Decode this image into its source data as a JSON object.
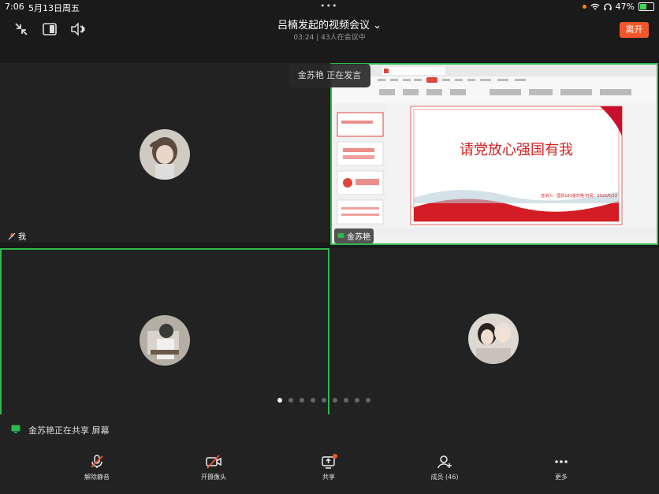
{
  "status": {
    "time": "7:06",
    "date": "5月13日周五",
    "battery": "47%",
    "battery_fraction": 0.47
  },
  "meeting": {
    "title": "吕楠发起的视频会议",
    "duration": "03:24",
    "attendees": "43人在会议中",
    "leave_label": "离开"
  },
  "speaking_banner": {
    "name": "金苏艳",
    "text": "正在发言"
  },
  "tiles": {
    "self_label": "我",
    "presenter_label": "金苏艳"
  },
  "slide": {
    "heading": "请党放心强国有我",
    "footer": "宣讲人：国贸181金苏艳   时间：2022/5/13"
  },
  "share_notice": "金苏艳正在共享 屏幕",
  "toolbar": {
    "unmute": "解除静音",
    "camera": "开摄像头",
    "share": "共享",
    "members": "成员 (46)",
    "more": "更多"
  },
  "colors": {
    "accent": "#f2562b",
    "active_border": "#2db84d",
    "share_icon": "#2db84d"
  }
}
